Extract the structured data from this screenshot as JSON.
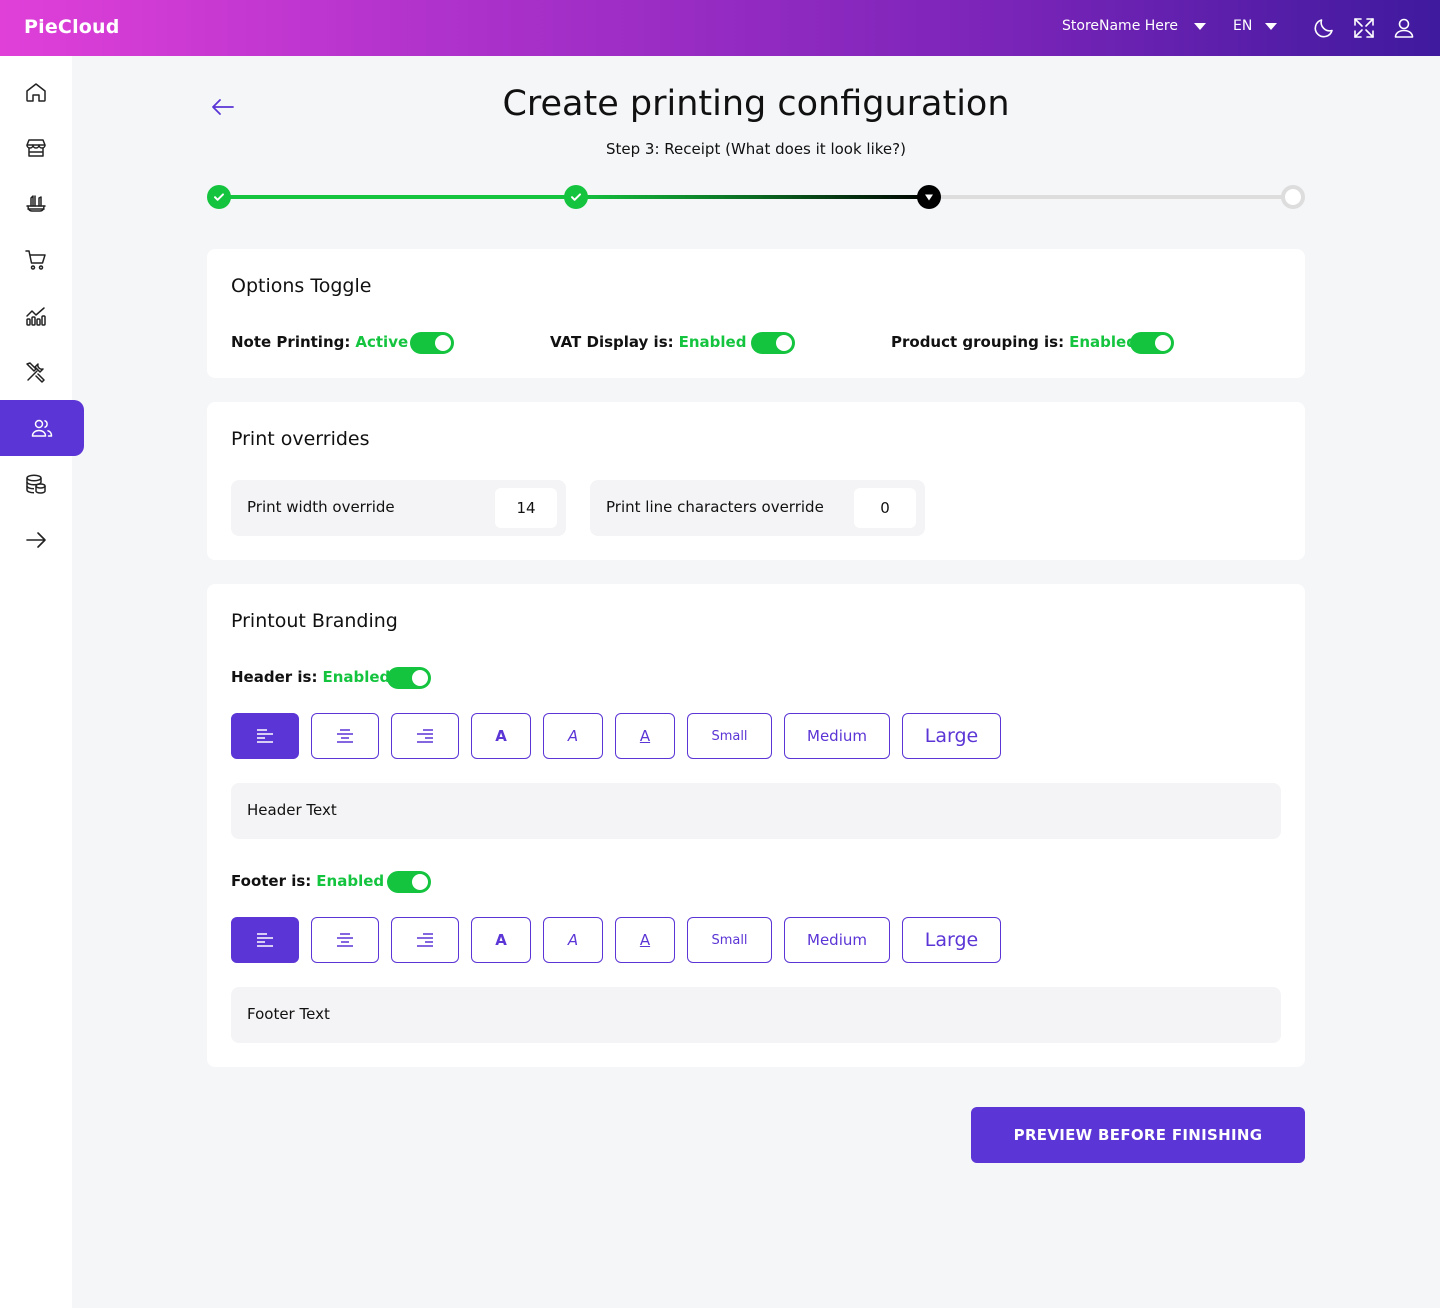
{
  "app": {
    "brand": "PieCloud"
  },
  "header": {
    "store_name": "StoreName Here",
    "language": "EN",
    "icons": [
      "moon-icon",
      "fullscreen-icon",
      "user-icon"
    ]
  },
  "sidebar": {
    "items": [
      {
        "icon": "home-icon"
      },
      {
        "icon": "store-icon"
      },
      {
        "icon": "food-icon"
      },
      {
        "icon": "cart-icon"
      },
      {
        "icon": "analytics-icon"
      },
      {
        "icon": "tools-icon"
      },
      {
        "icon": "users-icon",
        "active": true
      },
      {
        "icon": "database-icon"
      },
      {
        "icon": "arrow-right-icon"
      }
    ]
  },
  "page": {
    "title": "Create printing configuration",
    "step_label": "Step 3:  Receipt (What does it look like?)"
  },
  "stepper": {
    "total_steps": 4,
    "current_step": 3
  },
  "options": {
    "title": "Options Toggle",
    "note_printing": {
      "label": "Note Printing:",
      "status": "Active",
      "on": true
    },
    "vat_display": {
      "label": "VAT Display is:",
      "status": "Enabled",
      "on": true
    },
    "product_grouping": {
      "label": "Product grouping is:",
      "status": "Enabled",
      "on": true
    }
  },
  "overrides": {
    "title": "Print overrides",
    "width": {
      "label": "Print width override",
      "value": "14"
    },
    "line_chars": {
      "label": "Print line characters override",
      "value": "0"
    }
  },
  "branding": {
    "title": "Printout Branding",
    "header": {
      "label": "Header is:",
      "status": "Enabled",
      "on": true,
      "text": "Header Text",
      "active_align": "left"
    },
    "footer": {
      "label": "Footer is:",
      "status": "Enabled",
      "on": true,
      "text": "Footer Text",
      "active_align": "left"
    },
    "buttons": {
      "bold": "A",
      "italic": "A",
      "underline": "A",
      "small": "Small",
      "medium": "Medium",
      "large": "Large"
    }
  },
  "actions": {
    "preview": "PREVIEW BEFORE FINISHING"
  },
  "colors": {
    "accent": "#5b35d5",
    "success": "#14c43f",
    "pending": "#dddddd"
  }
}
